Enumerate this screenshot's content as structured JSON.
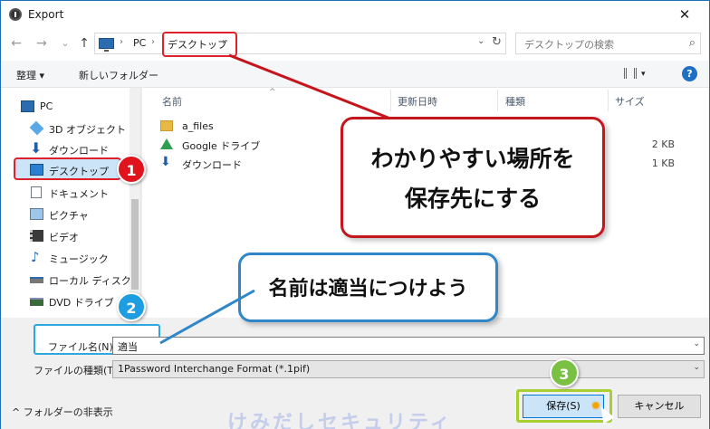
{
  "window": {
    "title": "Export",
    "close_glyph": "✕"
  },
  "nav": {
    "back": "←",
    "forward": "→",
    "recent": "⌄",
    "up": "↑",
    "breadcrumb": [
      "PC",
      "デスクトップ"
    ],
    "crumb_separator": "›",
    "refresh": "↻",
    "search_placeholder": "デスクトップの検索"
  },
  "toolbar": {
    "organize": "整理 ▾",
    "new_folder": "新しいフォルダー",
    "view_glyph": "▾",
    "help": "?"
  },
  "sidebar": {
    "items": [
      {
        "label": "PC",
        "icon": "pc-icon"
      },
      {
        "label": "3D オブジェクト",
        "icon": "cube-icon"
      },
      {
        "label": "ダウンロード",
        "icon": "download-icon"
      },
      {
        "label": "デスクトップ",
        "icon": "desktop-icon",
        "selected": true
      },
      {
        "label": "ドキュメント",
        "icon": "document-icon"
      },
      {
        "label": "ピクチャ",
        "icon": "picture-icon"
      },
      {
        "label": "ビデオ",
        "icon": "video-icon"
      },
      {
        "label": "ミュージック",
        "icon": "music-icon"
      },
      {
        "label": "ローカル ディスク (C",
        "icon": "disk-icon"
      },
      {
        "label": "DVD ドライブ (D",
        "icon": "dvd-icon"
      }
    ]
  },
  "filelist": {
    "columns": [
      "名前",
      "更新日時",
      "種類",
      "サイズ"
    ],
    "sort_glyph": "^",
    "rows": [
      {
        "name": "a_files",
        "size": "",
        "icon": "folder-icon"
      },
      {
        "name": "Google ドライブ",
        "size": "2 KB",
        "icon": "google-drive-icon"
      },
      {
        "name": "ダウンロード",
        "size": "1 KB",
        "icon": "download-icon"
      }
    ]
  },
  "form": {
    "filename_label": "ファイル名(N):",
    "filename_value": "適当",
    "filetype_label": "ファイルの種類(T):",
    "filetype_value": "1Password Interchange Format (*.1pif)",
    "dropdown_glyph": "⌄",
    "hide_folders": "^  フォルダーの非表示",
    "save": "保存(S)",
    "cancel": "キャンセル"
  },
  "annotations": {
    "callout_location": [
      "わかりやすい場所を",
      "保存先にする"
    ],
    "callout_name": "名前は適当につけよう",
    "badges": [
      "1",
      "2",
      "3"
    ],
    "watermark": "けみだしセキュリティ",
    "colors": {
      "red": "#c4161c",
      "blue": "#2f86c8",
      "green": "#a6cf2f",
      "badge_red": "#e0141c",
      "badge_blue": "#1e9ee0",
      "badge_green": "#7ac143"
    }
  }
}
